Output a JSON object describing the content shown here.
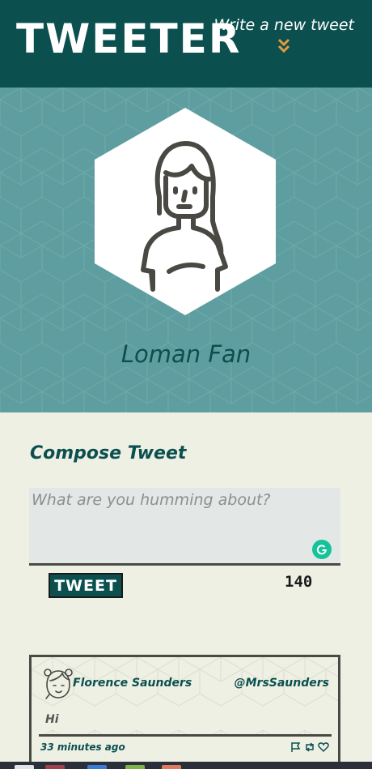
{
  "nav": {
    "brand": "TWEETER",
    "write_link": "Write a new tweet",
    "chevron_icon": "double-chevron-down-icon",
    "chevron_color": "#e89a3c"
  },
  "profile": {
    "name": "Loman Fan",
    "avatar_icon": "user-avatar-icon"
  },
  "compose": {
    "title": "Compose Tweet",
    "placeholder": "What are you humming about?",
    "value": "",
    "button_label": "TWEET",
    "counter": "140"
  },
  "tweets": [
    {
      "author": "Florence Saunders",
      "handle": "@MrsSaunders",
      "content": "Hi",
      "time_ago": "33 minutes ago",
      "actions": [
        "flag-icon",
        "retweet-icon",
        "heart-icon"
      ]
    }
  ],
  "colors": {
    "primary": "#0b4f4f",
    "header_bg": "#5f9ea0",
    "page_bg": "#eef0e4",
    "border": "#4a4a45",
    "grammarly": "#15c39a"
  }
}
